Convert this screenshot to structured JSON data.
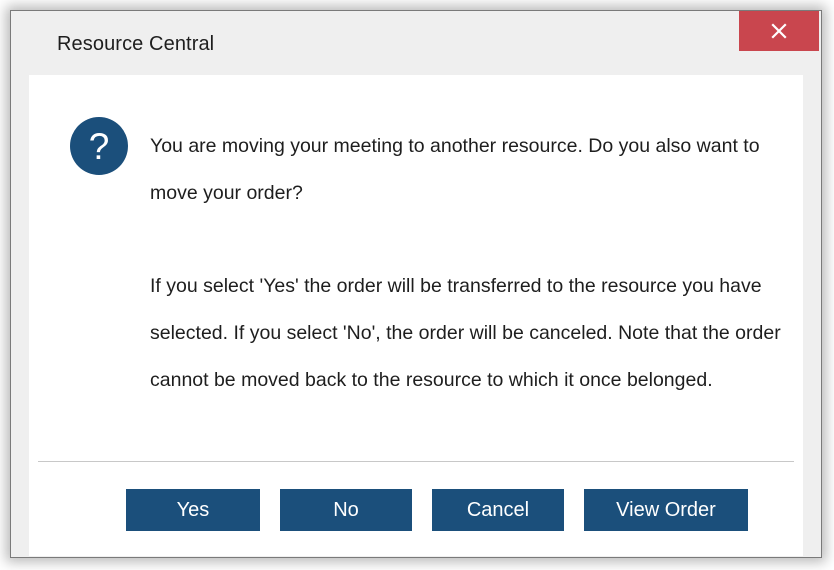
{
  "window": {
    "title": "Resource Central",
    "close_label": "×"
  },
  "message": {
    "icon": "question-icon",
    "paragraph1": "You are moving your meeting to another resource. Do you also want to move your order?",
    "paragraph2": "If you select 'Yes' the order will be transferred to the resource you have selected. If you select 'No', the order will be canceled. Note that the order cannot be moved back to the resource to which it once belonged."
  },
  "buttons": {
    "yes": "Yes",
    "no": "No",
    "cancel": "Cancel",
    "view_order": "View Order"
  },
  "colors": {
    "close_button": "#c9464e",
    "primary_button": "#1b4f7b",
    "icon": "#1b4f7b"
  }
}
